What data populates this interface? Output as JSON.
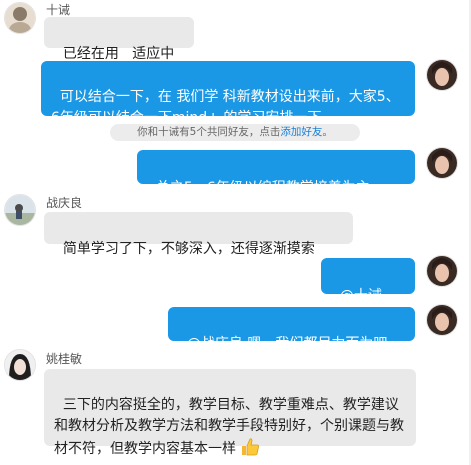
{
  "messages": [
    {
      "sender": "十诫",
      "text": "已经在用   适应中"
    },
    {
      "text": "可以结合一下，在 我们学 科新教材设出来前，大家5、6年级可以结合一下mind+ 的学习安排一下"
    },
    {
      "text": "总之5、6年级以编程教学培养为主，"
    },
    {
      "sender": "战庆良",
      "text": "简单学习了下，不够深入，还得逐渐摸索"
    },
    {
      "text": "@十诫 "
    },
    {
      "text": "@战庆良 嗯，我们都尽力而为吧"
    },
    {
      "sender": "姚桂敏",
      "text": "三下的内容挺全的，教学目标、教学重难点、教学建议和教材分析及教学方法和教学手段特别好，个别课题与教材不符，但教学内容基本一样"
    }
  ],
  "system_notice": {
    "text": "你和十诫有5个共同好友，点击",
    "link": "添加好友",
    "suffix": "。"
  },
  "icons": {
    "thumbs_up": "thumbs-up-emoji"
  },
  "colors": {
    "outgoing_bubble": "#1a98e6",
    "incoming_bubble": "#e9e9ea",
    "link": "#1a7fd6"
  }
}
